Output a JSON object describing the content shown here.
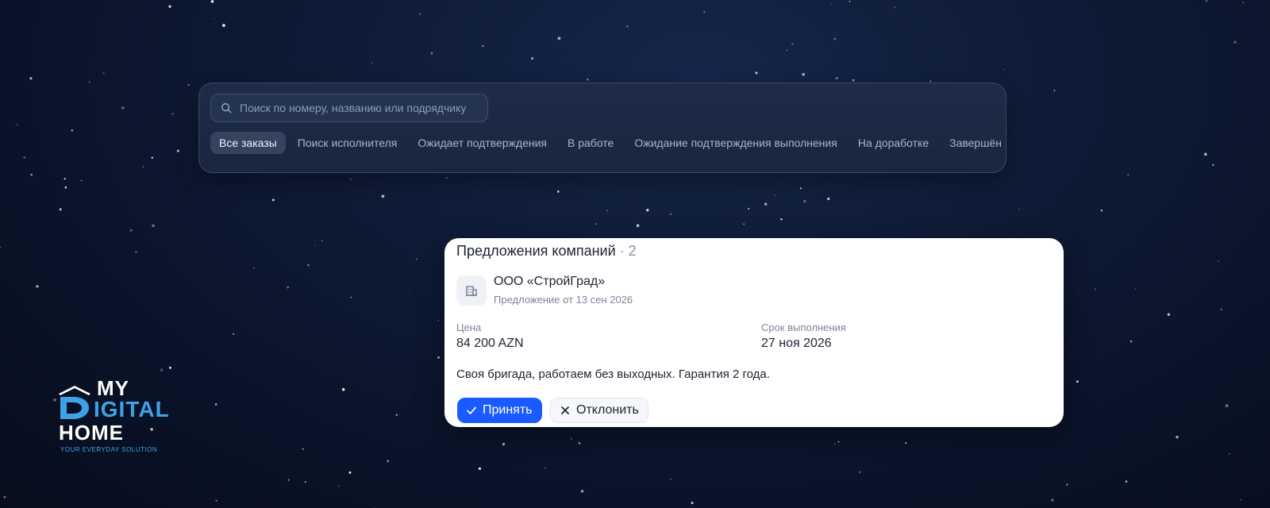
{
  "search": {
    "placeholder": "Поиск по номеру, названию или подрядчику",
    "value": ""
  },
  "tabs": [
    {
      "label": "Все заказы",
      "active": true
    },
    {
      "label": "Поиск исполнителя",
      "active": false
    },
    {
      "label": "Ожидает подтверждения",
      "active": false
    },
    {
      "label": "В работе",
      "active": false
    },
    {
      "label": "Ожидание подтверждения выполнения",
      "active": false
    },
    {
      "label": "На доработке",
      "active": false
    },
    {
      "label": "Завершён",
      "active": false
    }
  ],
  "offers": {
    "title": "Предложения компаний",
    "count_text": "· 2",
    "company_icon": "building-icon",
    "company_name": "ООО «СтройГрад»",
    "offer_date": "Предложение от 13 сен 2026",
    "price_label": "Цена",
    "price_value": "84 200 AZN",
    "deadline_label": "Срок выполнения",
    "deadline_value": "27 ноя 2026",
    "comment": "Своя бригада, работаем без выходных. Гарантия 2 года.",
    "accept_label": "Принять",
    "reject_label": "Отклонить"
  },
  "logo": {
    "line1": "MY",
    "line2": "IGITAL",
    "line3": "HOME",
    "tagline": "YOUR EVERYDAY SOLUTION"
  },
  "colors": {
    "background": "#0c1530",
    "accent": "#1a5bff",
    "logo_blue": "#3ea2e8",
    "card": "#ffffff"
  }
}
